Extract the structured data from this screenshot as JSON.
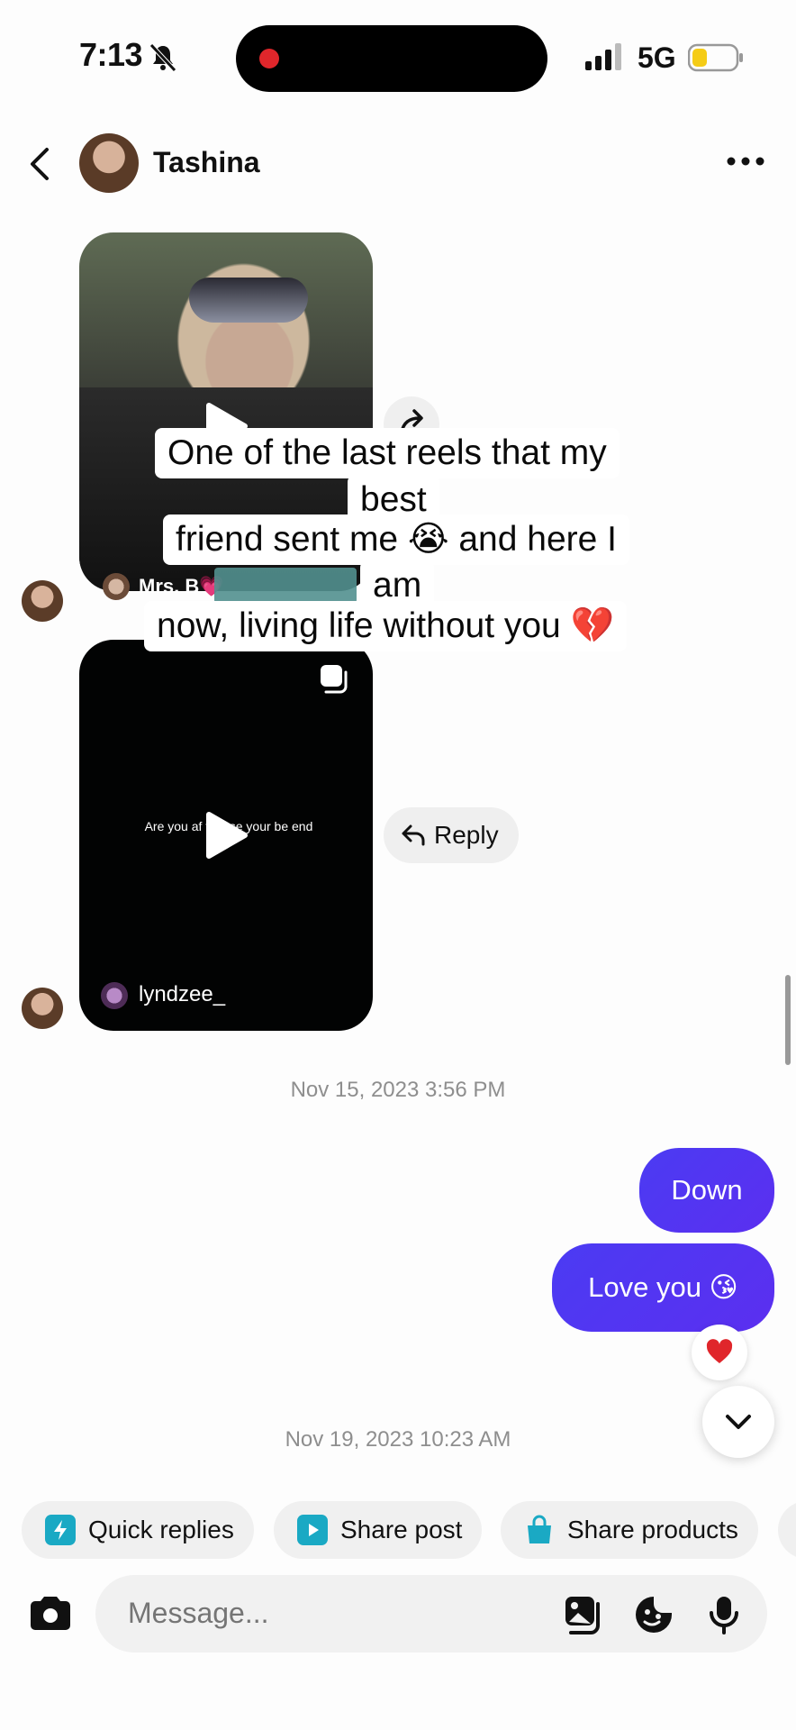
{
  "status_bar": {
    "time": "7:13",
    "network": "5G"
  },
  "header": {
    "contact_name": "Tashina"
  },
  "messages": {
    "reel1_username": "Mrs. B💗",
    "reel2_username": "lyndzee_",
    "reel2_caption": "Are you af      to lose your be      end",
    "reply_label": "Reply"
  },
  "overlay_caption": {
    "line1": "One of the last reels that my",
    "line2": "best",
    "line3": "friend sent me 😭 and here I",
    "line4": "am",
    "line5": "now, living life without you 💔"
  },
  "timestamps": {
    "first": "Nov 15, 2023 3:56 PM",
    "second": "Nov 19, 2023 10:23 AM"
  },
  "sent": {
    "msg1": "Down",
    "msg2": "Love you 😘",
    "reaction": "❤️"
  },
  "quick_actions": [
    {
      "label": "Quick replies"
    },
    {
      "label": "Share post"
    },
    {
      "label": "Share products"
    }
  ],
  "composer": {
    "placeholder": "Message..."
  },
  "colors": {
    "bubble": "#4b3bf3",
    "chip_icon": "#1aa9c4",
    "heart": "#e0262b"
  }
}
